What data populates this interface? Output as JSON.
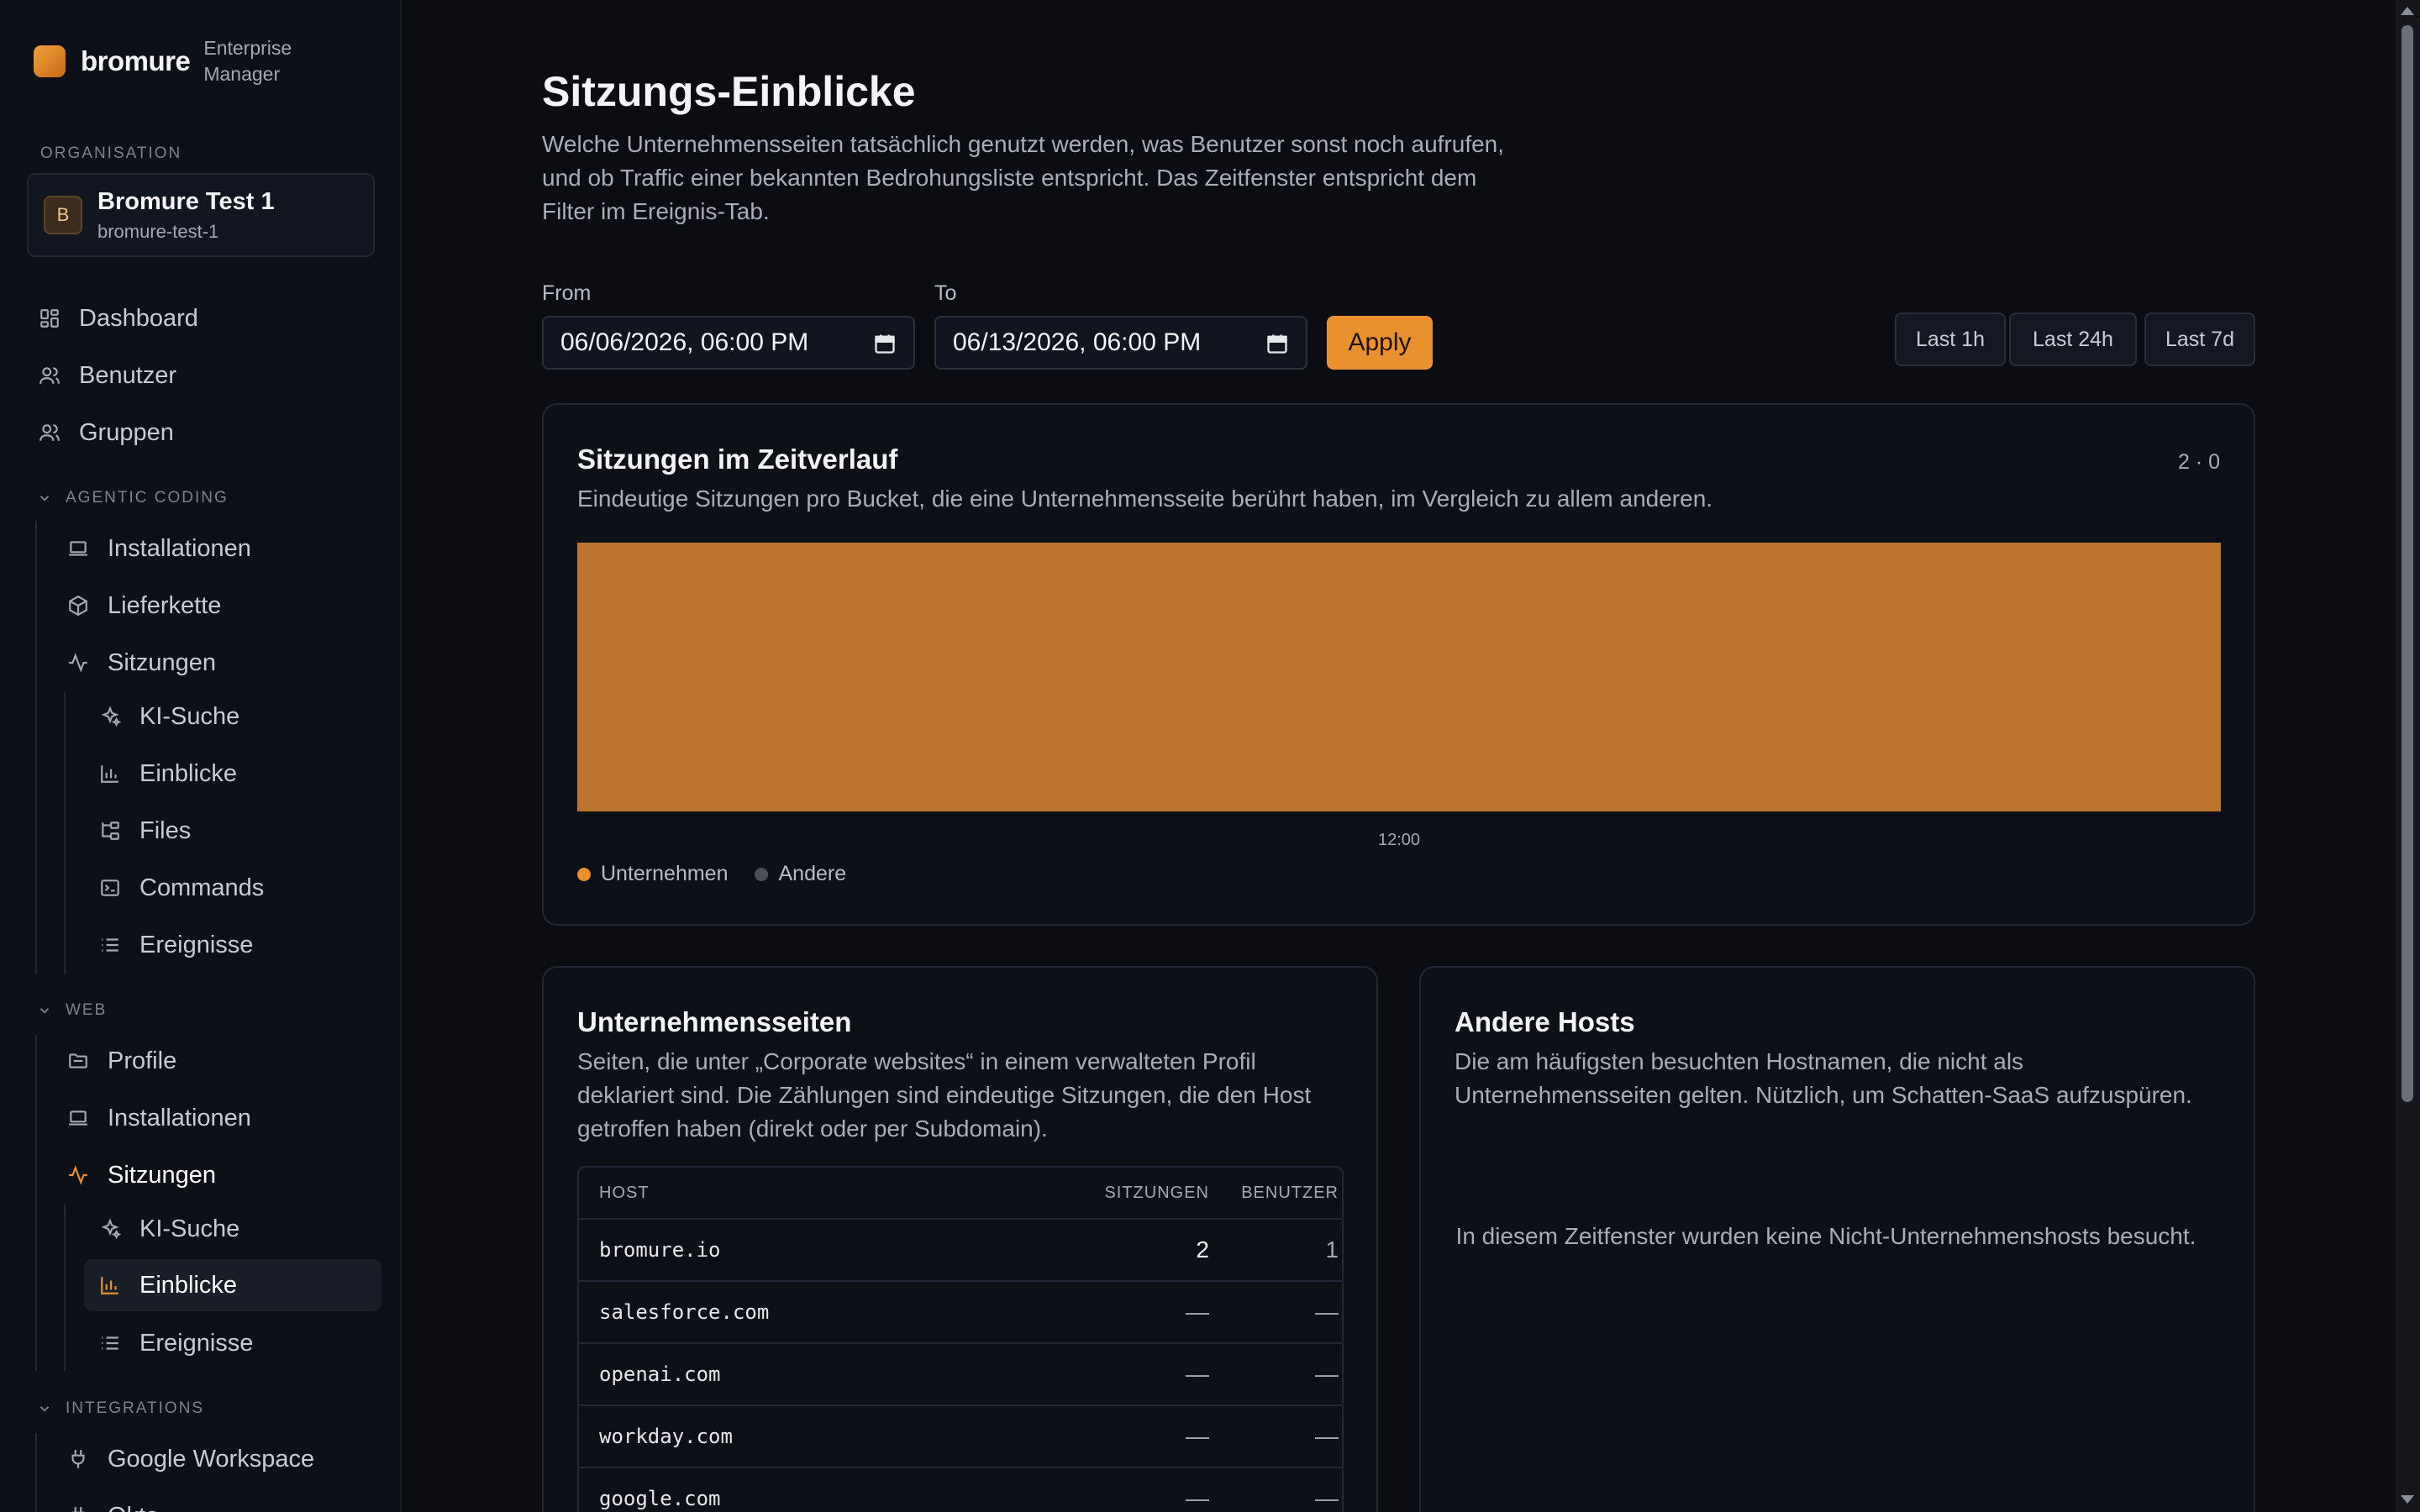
{
  "brand": {
    "name": "bromure",
    "sub": "Enterprise Manager"
  },
  "org": {
    "label": "ORGANISATION",
    "avatar": "B",
    "name": "Bromure Test 1",
    "slug": "bromure-test-1"
  },
  "nav": {
    "dashboard": "Dashboard",
    "benutzer": "Benutzer",
    "gruppen": "Gruppen",
    "agentic": {
      "label": "AGENTIC CODING",
      "installationen": "Installationen",
      "lieferkette": "Lieferkette",
      "sitzungen": "Sitzungen",
      "ki_suche": "KI-Suche",
      "einblicke": "Einblicke",
      "files": "Files",
      "commands": "Commands",
      "ereignisse": "Ereignisse"
    },
    "web": {
      "label": "WEB",
      "profile": "Profile",
      "installationen": "Installationen",
      "sitzungen": "Sitzungen",
      "ki_suche": "KI-Suche",
      "einblicke": "Einblicke",
      "ereignisse": "Ereignisse"
    },
    "integrations": {
      "label": "INTEGRATIONS",
      "google": "Google Workspace",
      "next": "Okta"
    }
  },
  "page": {
    "title": "Sitzungs-Einblicke",
    "description": "Welche Unternehmensseiten tatsächlich genutzt werden, was Benutzer sonst noch aufrufen, und ob Traffic einer bekannten Bedrohungsliste entspricht. Das Zeitfenster entspricht dem Filter im Ereignis-Tab."
  },
  "filter": {
    "from_label": "From",
    "from_value": "06/06/2026, 06:00 PM",
    "to_label": "To",
    "to_value": "06/13/2026, 06:00 PM",
    "apply": "Apply",
    "ranges": [
      "Last 1h",
      "Last 24h",
      "Last 7d"
    ]
  },
  "timeline": {
    "title": "Sitzungen im Zeitverlauf",
    "description": "Eindeutige Sitzungen pro Bucket, die eine Unternehmensseite berührt haben, im Vergleich zu allem anderen.",
    "count": "2 · 0",
    "legend": [
      "Unternehmen",
      "Andere"
    ]
  },
  "colors": {
    "accent": "#e9902f",
    "bar": "#bd742e",
    "other": "#4a4e59"
  },
  "chart_data": {
    "type": "bar",
    "categories": [
      "12:00"
    ],
    "series": [
      {
        "name": "Unternehmen",
        "values": [
          2
        ]
      },
      {
        "name": "Andere",
        "values": [
          0
        ]
      }
    ],
    "ylim": [
      0,
      2
    ],
    "legend_position": "bottom-left",
    "grid": false
  },
  "corporate": {
    "title": "Unternehmensseiten",
    "description": "Seiten, die unter „Corporate websites“ in einem verwalteten Profil deklariert sind. Die Zählungen sind eindeutige Sitzungen, die den Host getroffen haben (direkt oder per Subdomain).",
    "columns": [
      "HOST",
      "SITZUNGEN",
      "BENUTZER"
    ],
    "rows": [
      [
        "bromure.io",
        "2",
        "1"
      ],
      [
        "salesforce.com",
        "—",
        "—"
      ],
      [
        "openai.com",
        "—",
        "—"
      ],
      [
        "workday.com",
        "—",
        "—"
      ],
      [
        "google.com",
        "—",
        "—"
      ]
    ]
  },
  "other_hosts": {
    "title": "Andere Hosts",
    "description": "Die am häufigsten besuchten Hostnamen, die nicht als Unternehmensseiten gelten. Nützlich, um Schatten-SaaS aufzuspüren.",
    "empty": "In diesem Zeitfenster wurden keine Nicht-Unternehmenshosts besucht."
  }
}
